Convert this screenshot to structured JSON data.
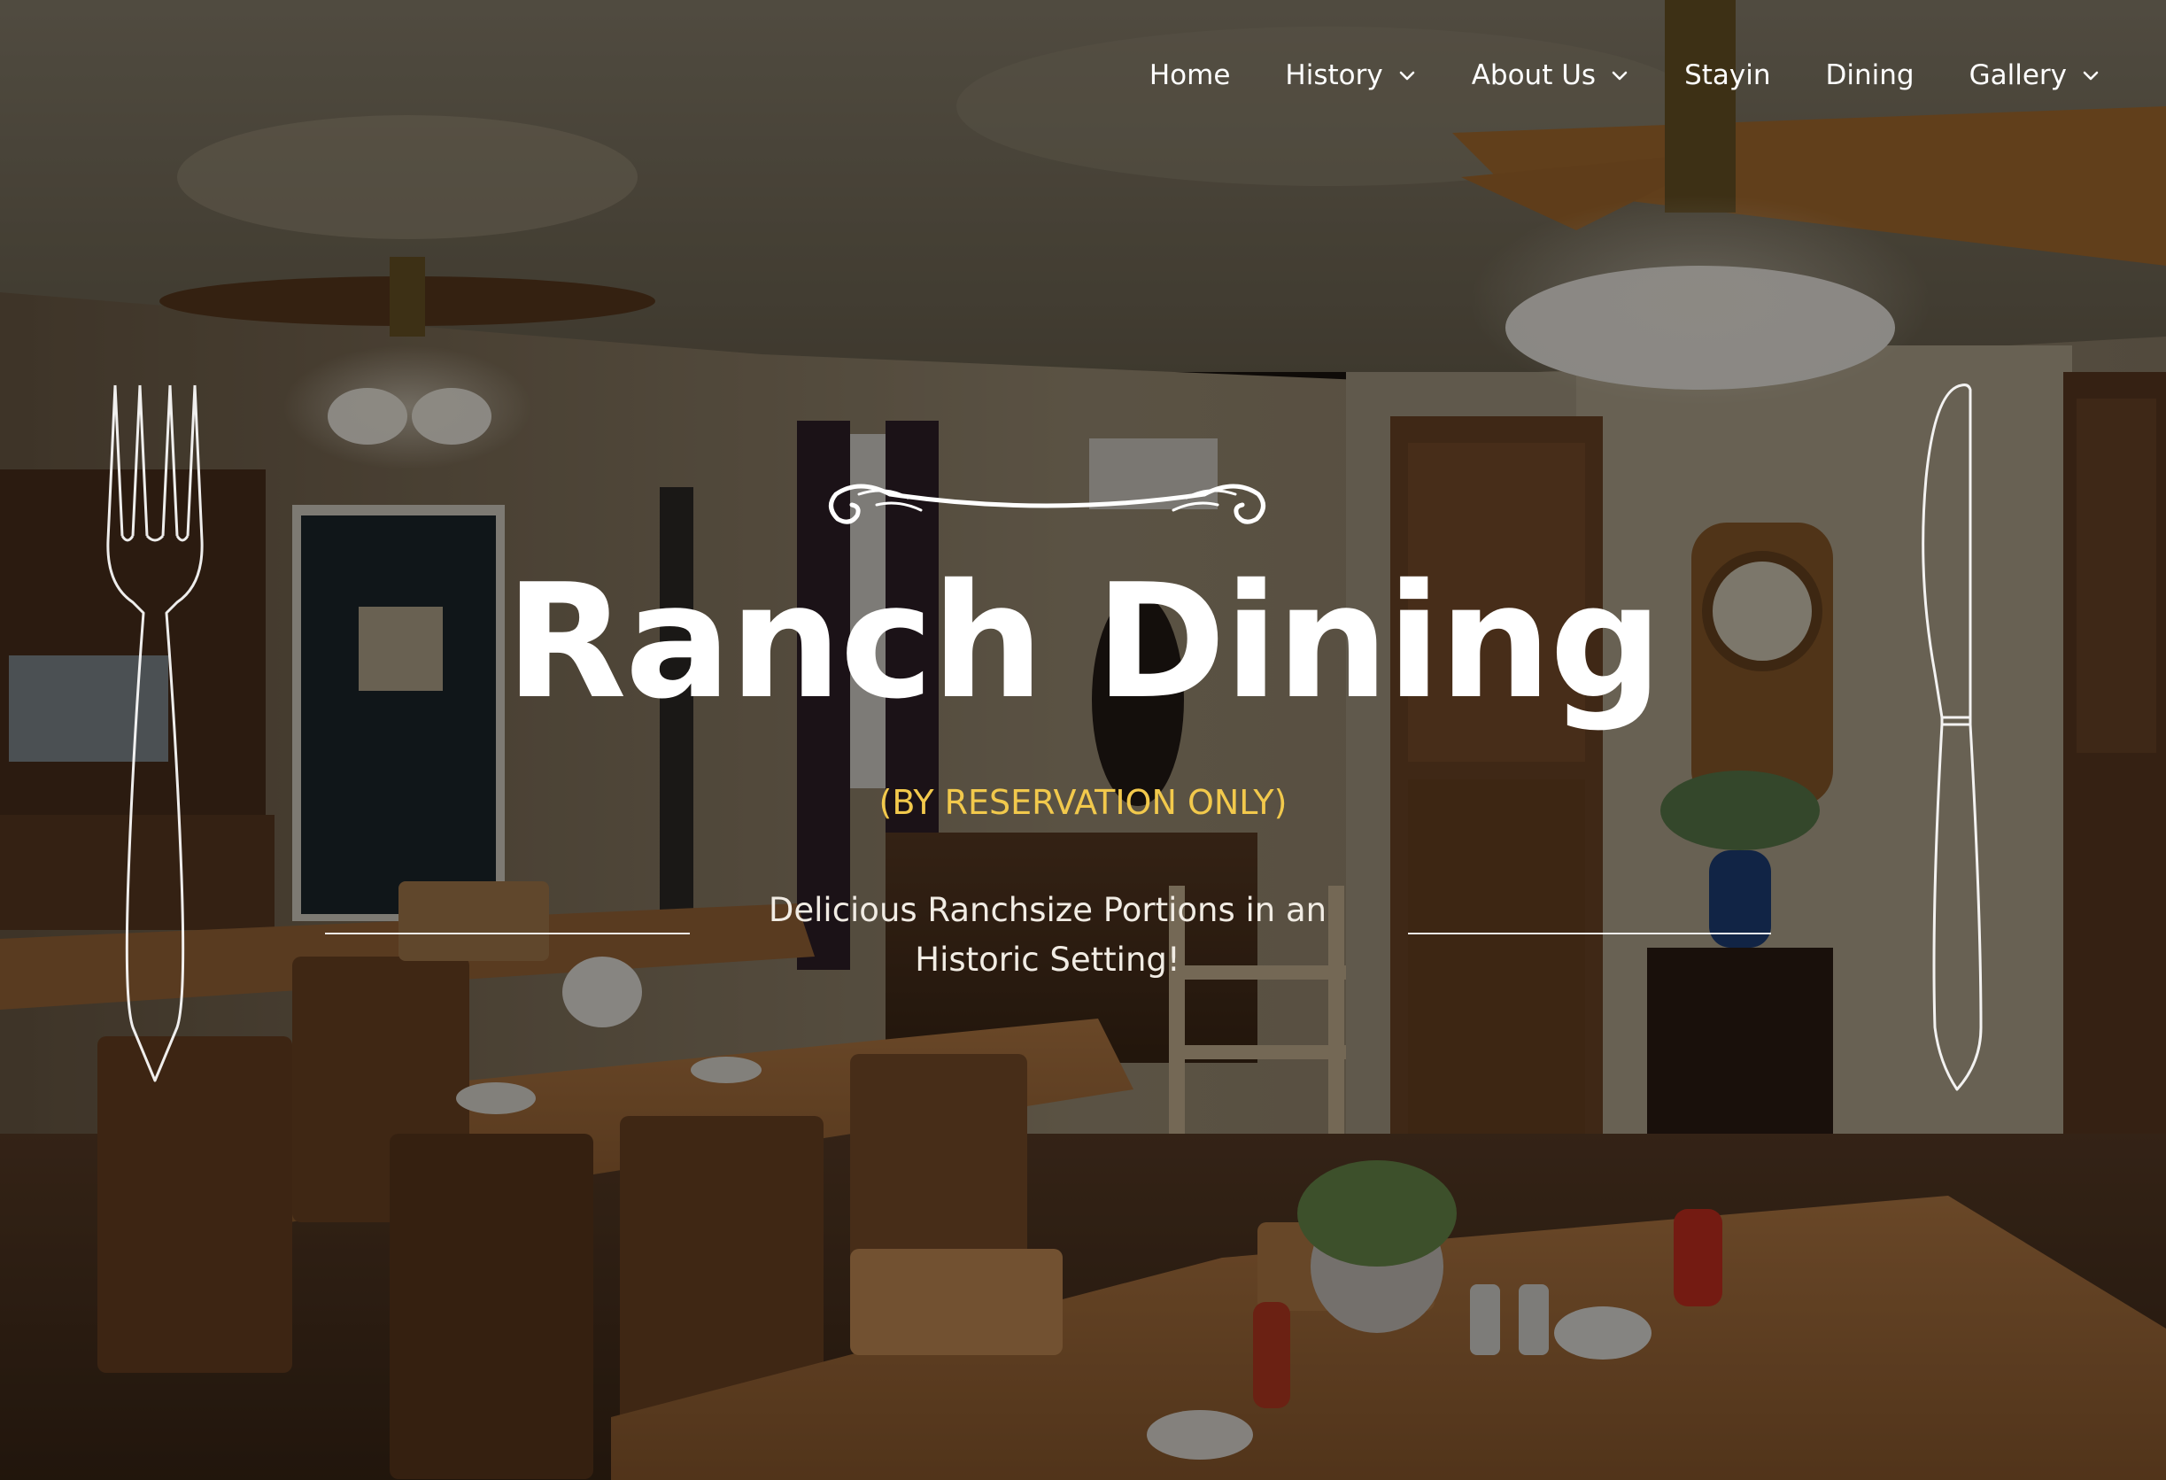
{
  "nav": {
    "items": [
      {
        "label": "Home",
        "has_dropdown": false
      },
      {
        "label": "History",
        "has_dropdown": true
      },
      {
        "label": "About Us",
        "has_dropdown": true
      },
      {
        "label": "Stayin",
        "has_dropdown": false
      },
      {
        "label": "Dining",
        "has_dropdown": false
      },
      {
        "label": "Gallery",
        "has_dropdown": true
      }
    ]
  },
  "hero": {
    "title": "Ranch Dining",
    "subtitle": "(BY RESERVATION ONLY)",
    "tagline_line1": "Delicious Ranchsize Portions in an",
    "tagline_line2": "Historic Setting!"
  },
  "colors": {
    "accent_yellow": "#f2c94c",
    "text_white": "#ffffff",
    "overlay": "#000000"
  },
  "icons": [
    "chevron-down-icon",
    "fork-icon",
    "knife-icon",
    "flourish-divider-icon"
  ]
}
